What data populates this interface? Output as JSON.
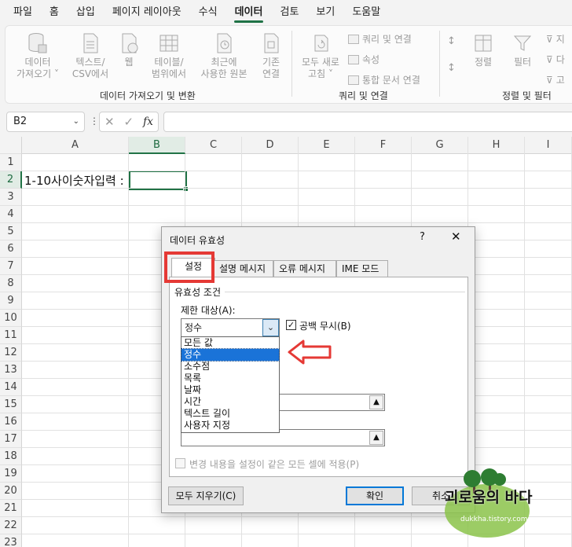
{
  "ribbon_tabs": [
    "파일",
    "홈",
    "삽입",
    "페이지 레이아웃",
    "수식",
    "데이터",
    "검토",
    "보기",
    "도움말"
  ],
  "active_tab": "데이터",
  "ribbon": {
    "get_data": [
      "데이터",
      "가져오기 ˅"
    ],
    "text_csv": [
      "텍스트/",
      "CSV에서"
    ],
    "web": [
      "웹"
    ],
    "from_table": [
      "테이블/",
      "범위에서"
    ],
    "recent_sources": [
      "최근에",
      "사용한 원본"
    ],
    "existing_connections": [
      "기존",
      "연결"
    ],
    "refresh_all": [
      "모두 새로",
      "고침 ˅"
    ],
    "queries_connections": "쿼리 및 연결",
    "properties": "속성",
    "edit_links": "통합 문서 연결",
    "sort": "정렬",
    "filter": "필터",
    "clear": "지",
    "reapply": "다",
    "advanced": "고",
    "group_get_transform": "데이터 가져오기 및 변환",
    "group_queries": "쿼리 및 연결",
    "group_sort_filter": "정렬 및 필터"
  },
  "formula_bar": {
    "name_box": "B2",
    "fx": "fx",
    "content": ""
  },
  "columns": [
    "A",
    "B",
    "C",
    "D",
    "E",
    "F",
    "G",
    "H",
    "I"
  ],
  "selected_column": "B",
  "rows": [
    "1",
    "2",
    "3",
    "4",
    "5",
    "6",
    "7",
    "8",
    "9",
    "10",
    "11",
    "12",
    "13",
    "14",
    "15",
    "16",
    "17",
    "18",
    "19",
    "20",
    "21",
    "22",
    "23"
  ],
  "selected_row": "2",
  "cells": {
    "A2": "1-10사이숫자입력 :"
  },
  "dialog": {
    "title": "데이터 유효성",
    "help": "?",
    "close": "✕",
    "tabs": [
      "설정",
      "설명 메시지",
      "오류 메시지",
      "IME 모드"
    ],
    "active_tab": "설정",
    "section_title": "유효성 조건",
    "allow_label": "제한 대상(A):",
    "allow_value": "정수",
    "ignore_blank_label": "공백 무시(B)",
    "ignore_blank_checked": true,
    "options": [
      "모든 값",
      "정수",
      "소수점",
      "목록",
      "날짜",
      "시간",
      "텍스트 길이",
      "사용자 지정"
    ],
    "selected_option": "정수",
    "apply_all_label": "변경 내용을 설정이 같은 모든 셀에 적용(P)",
    "clear_all_button": "모두 지우기(C)",
    "ok_button": "확인",
    "cancel_button": "취소"
  },
  "watermark": {
    "text": "괴로움의 바다",
    "url": "dukkha.tistory.com"
  },
  "colors": {
    "excel_green": "#217346",
    "annotation_red": "#e53935",
    "selection_blue": "#1a73d8"
  }
}
